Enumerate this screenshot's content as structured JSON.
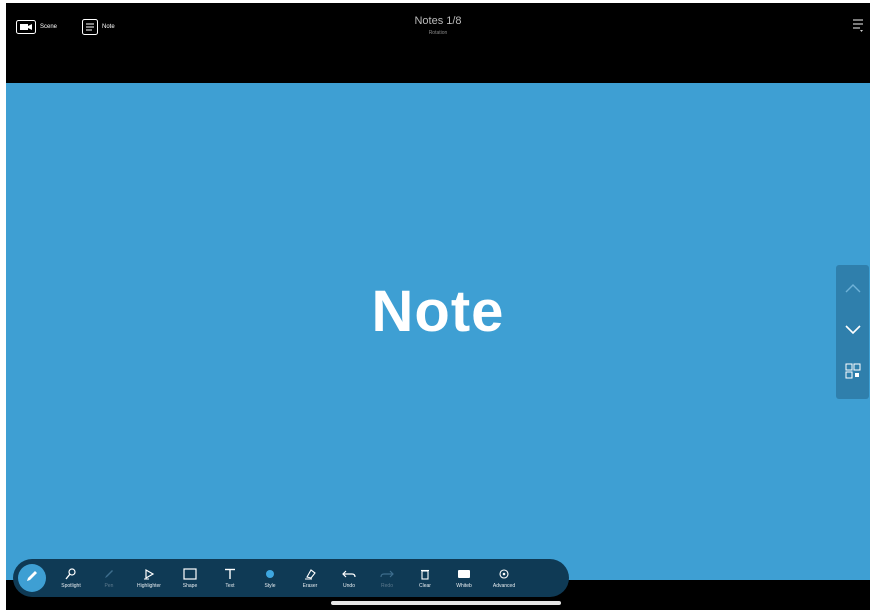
{
  "topbar": {
    "scene_label": "Scene",
    "note_label": "Note",
    "title": "Notes 1/8",
    "subtitle": "Rotation"
  },
  "canvas": {
    "background": "#3e9fd3",
    "text": "Note"
  },
  "side_nav": {
    "icons": [
      "chevron-up-icon",
      "chevron-down-icon",
      "grid-icon"
    ]
  },
  "toolbar": {
    "active_tool": "pen",
    "tools": [
      {
        "name": "spotlight",
        "label": "Spotlight",
        "icon": "spotlight-icon"
      },
      {
        "name": "pen",
        "label": "Pen",
        "icon": "pen-icon"
      },
      {
        "name": "highlighter",
        "label": "Highlighter",
        "icon": "highlighter-icon"
      },
      {
        "name": "shape",
        "label": "Shape",
        "icon": "rectangle-icon"
      },
      {
        "name": "text",
        "label": "Text",
        "icon": "text-icon"
      },
      {
        "name": "style",
        "label": "Style",
        "icon": "color-dot-icon"
      },
      {
        "name": "eraser",
        "label": "Eraser",
        "icon": "eraser-icon"
      },
      {
        "name": "undo",
        "label": "Undo",
        "icon": "undo-icon"
      },
      {
        "name": "redo",
        "label": "Redo",
        "icon": "redo-icon"
      },
      {
        "name": "clear",
        "label": "Clear",
        "icon": "trash-icon"
      },
      {
        "name": "board",
        "label": "Whiteb",
        "icon": "board-icon"
      },
      {
        "name": "advanced",
        "label": "Advanced",
        "icon": "settings-icon"
      }
    ]
  },
  "colors": {
    "accent": "#3e9fd3",
    "toolbar_bg": "#0f3a55",
    "side_nav_bg": "#2f7fac"
  }
}
